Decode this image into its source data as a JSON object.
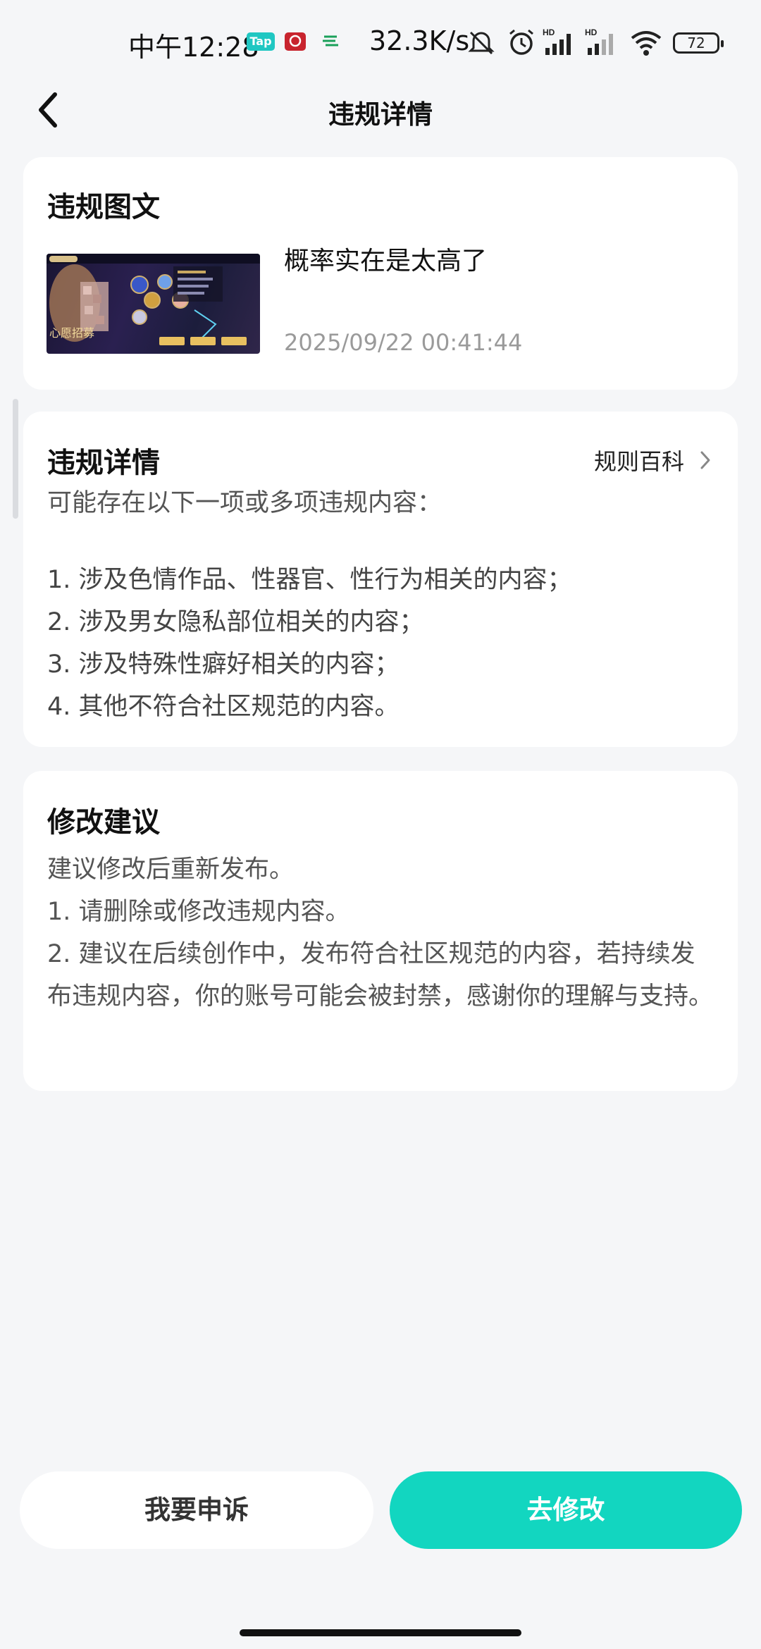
{
  "status_bar": {
    "time": "中午12:28",
    "tap_label": "Tap",
    "network_speed": "32.3K/s",
    "battery": "72"
  },
  "header": {
    "title": "违规详情"
  },
  "violation_content": {
    "section_title": "违规图文",
    "post_text": "概率实在是太高了",
    "post_time": "2025/09/22 00:41:44"
  },
  "violation_detail": {
    "section_title": "违规详情",
    "rule_link": "规则百科",
    "description": "可能存在以下一项或多项违规内容：",
    "items": [
      "1. 涉及色情作品、性器官、性行为相关的内容；",
      "2. 涉及男女隐私部位相关的内容；",
      "3. 涉及特殊性癖好相关的内容；",
      "4. 其他不符合社区规范的内容。"
    ]
  },
  "suggestion": {
    "section_title": "修改建议",
    "lines": [
      "建议修改后重新发布。",
      "1. 请删除或修改违规内容。",
      "2. 建议在后续创作中，发布符合社区规范的内容，若持续发布违规内容，你的账号可能会被封禁，感谢你的理解与支持。"
    ]
  },
  "actions": {
    "appeal_label": "我要申诉",
    "modify_label": "去修改"
  },
  "colors": {
    "accent": "#12d6c0",
    "background": "#f5f6f8"
  }
}
